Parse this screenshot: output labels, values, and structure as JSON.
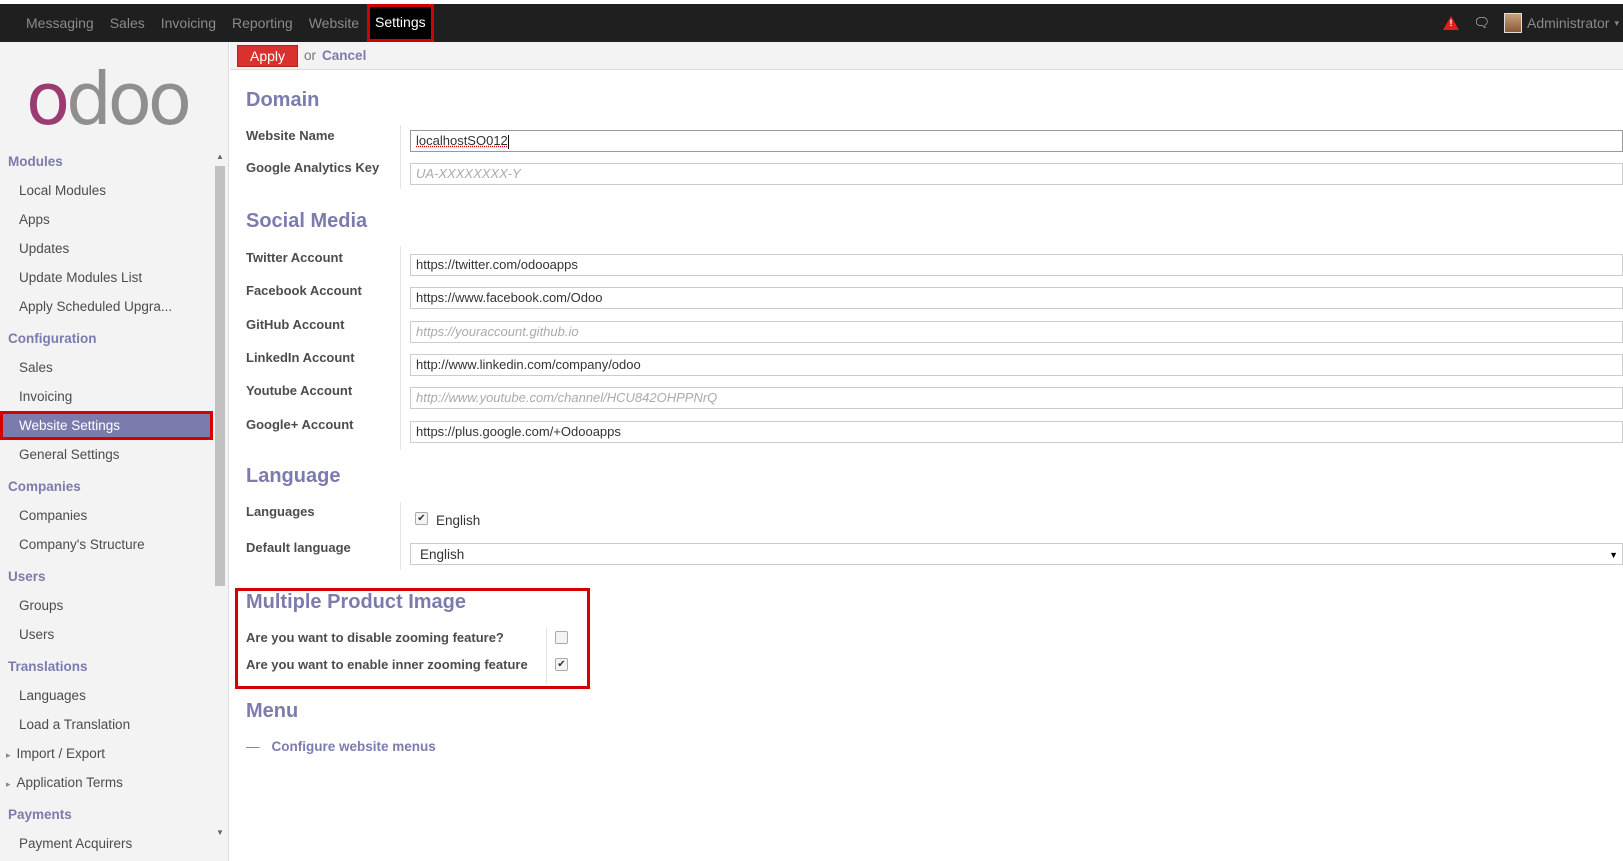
{
  "topbar": {
    "menu": [
      "Messaging",
      "Sales",
      "Invoicing",
      "Reporting",
      "Website",
      "Settings"
    ],
    "active": "Settings",
    "user": "Administrator"
  },
  "logo": "odoo",
  "sidebar": {
    "sections": [
      {
        "title": "Modules",
        "items": [
          "Local Modules",
          "Apps",
          "Updates",
          "Update Modules List",
          "Apply Scheduled Upgra..."
        ]
      },
      {
        "title": "Configuration",
        "items": [
          "Sales",
          "Invoicing",
          "Website Settings",
          "General Settings"
        ]
      },
      {
        "title": "Companies",
        "items": [
          "Companies",
          "Company's Structure"
        ]
      },
      {
        "title": "Users",
        "items": [
          "Groups",
          "Users"
        ]
      },
      {
        "title": "Translations",
        "items": [
          "Languages",
          "Load a Translation",
          "Import / Export",
          "Application Terms"
        ]
      },
      {
        "title": "Payments",
        "items": [
          "Payment Acquirers"
        ]
      }
    ],
    "active_item": "Website Settings"
  },
  "actions": {
    "apply": "Apply",
    "or": "or",
    "cancel": "Cancel"
  },
  "domain": {
    "title": "Domain",
    "website_name_label": "Website Name",
    "website_name_value": "localhostSO012",
    "analytics_label": "Google Analytics Key",
    "analytics_placeholder": "UA-XXXXXXXX-Y"
  },
  "social": {
    "title": "Social Media",
    "fields": [
      {
        "label": "Twitter Account",
        "value": "https://twitter.com/odooapps",
        "placeholder": false
      },
      {
        "label": "Facebook Account",
        "value": "https://www.facebook.com/Odoo",
        "placeholder": false
      },
      {
        "label": "GitHub Account",
        "value": "https://youraccount.github.io",
        "placeholder": true
      },
      {
        "label": "LinkedIn Account",
        "value": "http://www.linkedin.com/company/odoo",
        "placeholder": false
      },
      {
        "label": "Youtube Account",
        "value": "http://www.youtube.com/channel/HCU842OHPPNrQ",
        "placeholder": true
      },
      {
        "label": "Google+ Account",
        "value": "https://plus.google.com/+Odooapps",
        "placeholder": false
      }
    ]
  },
  "language": {
    "title": "Language",
    "languages_label": "Languages",
    "language_option": "English",
    "language_checked": true,
    "default_label": "Default language",
    "default_value": "English"
  },
  "mpi": {
    "title": "Multiple Product Image",
    "disable_label": "Are you want to disable zooming feature?",
    "disable_checked": false,
    "inner_label": "Are you want to enable inner zooming feature",
    "inner_checked": true
  },
  "menu_section": {
    "title": "Menu",
    "link": "Configure website menus"
  }
}
